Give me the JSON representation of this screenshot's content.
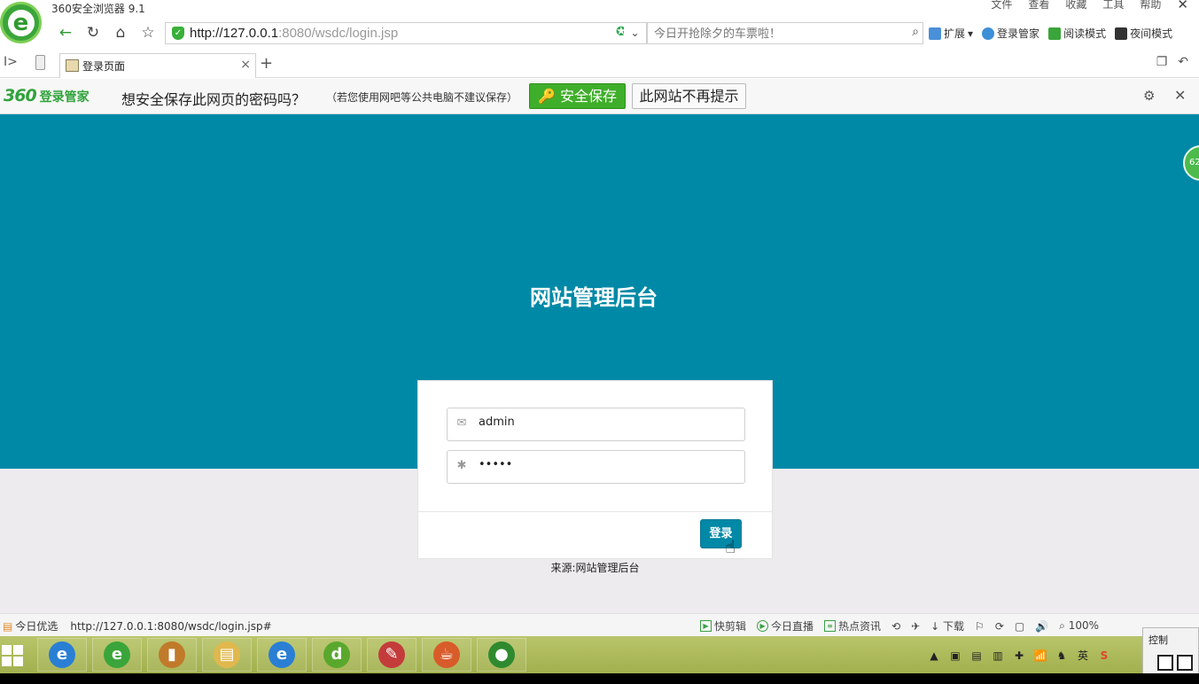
{
  "window": {
    "app_title": "360安全浏览器 9.1",
    "menu": [
      "文件",
      "查看",
      "收藏",
      "工具",
      "帮助"
    ],
    "close_glyph": "✕"
  },
  "navbar": {
    "back": "←",
    "reload": "↻",
    "home": "⌂",
    "favorite": "☆",
    "url_host": "http://127.0.0.1",
    "url_rest": ":8080/wsdc/login.jsp",
    "url_status_icons": "✪ ⚡",
    "dropdown": "⌄",
    "search_placeholder": "今日开抢除夕的车票啦！",
    "search_icon": "⌕",
    "tools": [
      {
        "label": "扩展",
        "color": "#4a90d9"
      },
      {
        "label": "登录管家",
        "color": "#3c8fd6"
      },
      {
        "label": "阅读模式",
        "color": "#3aa53a"
      },
      {
        "label": "夜间模式",
        "color": "#333333"
      }
    ]
  },
  "tabbar": {
    "sidebar_toggle": "I>",
    "tab_title": "登录页面",
    "tab_close": "×",
    "new_tab": "+",
    "right_icons": [
      "❐",
      "↶"
    ]
  },
  "password_bar": {
    "brand_360": "360",
    "brand_name": "登录管家",
    "question": "想安全保存此网页的密码吗？",
    "note": "（若您使用网吧等公共电脑不建议保存）",
    "save_label": "🔑 安全保存",
    "never_label": "此网站不再提示",
    "gear": "⚙",
    "close": "✕"
  },
  "page": {
    "hero_title": "网站管理后台",
    "float_ball_text": "62",
    "username_icon": "✉",
    "username_value": "admin",
    "password_icon": "✱",
    "password_value": "•••••",
    "login_label": "登录",
    "cursor": "☝",
    "source_text": "来源:网站管理后台",
    "colors": {
      "hero": "#0089a7",
      "button": "#0089a7",
      "background": "#eeebef"
    }
  },
  "statusbar": {
    "left": [
      "今日优选",
      "http://127.0.0.1:8080/wsdc/login.jsp#"
    ],
    "right": [
      "快剪辑",
      "今日直播",
      "热点资讯",
      "⟲",
      "✈",
      "↓ 下载",
      "⚐",
      "⟳",
      "▢",
      "🔊",
      "⌕ 100%"
    ]
  },
  "taskbar": {
    "apps": [
      {
        "name": "ie-icon",
        "glyph": "e",
        "color": "#2a7fd4"
      },
      {
        "name": "360-browser-icon",
        "glyph": "e",
        "color": "#3aa53a"
      },
      {
        "name": "book-icon",
        "glyph": "▮",
        "color": "#c07a2a"
      },
      {
        "name": "folder-icon",
        "glyph": "▤",
        "color": "#e1b84e"
      },
      {
        "name": "ie2-icon",
        "glyph": "e",
        "color": "#2a7fd4"
      },
      {
        "name": "dreamweaver-icon",
        "glyph": "d",
        "color": "#59a82d"
      },
      {
        "name": "notepad-icon",
        "glyph": "✎",
        "color": "#c43b3b"
      },
      {
        "name": "java-icon",
        "glyph": "☕",
        "color": "#d85b2a"
      },
      {
        "name": "paw-icon",
        "glyph": "●",
        "color": "#2f8a2f"
      }
    ],
    "tray": [
      "▲",
      "▣",
      "▤",
      "▥",
      "✚",
      "📶",
      "♞",
      "英",
      "S"
    ],
    "control_label": "控制"
  }
}
